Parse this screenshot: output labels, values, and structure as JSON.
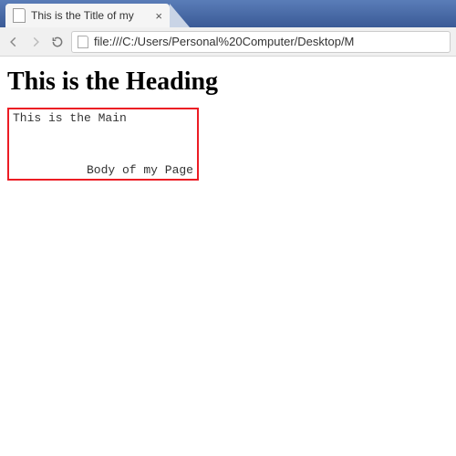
{
  "browser": {
    "tab_title": "This is the Title of my",
    "url": "file:///C:/Users/Personal%20Computer/Desktop/M"
  },
  "page": {
    "heading": "This is the Heading",
    "main_line1": "This is the Main",
    "main_line2": "Body of my Page"
  }
}
